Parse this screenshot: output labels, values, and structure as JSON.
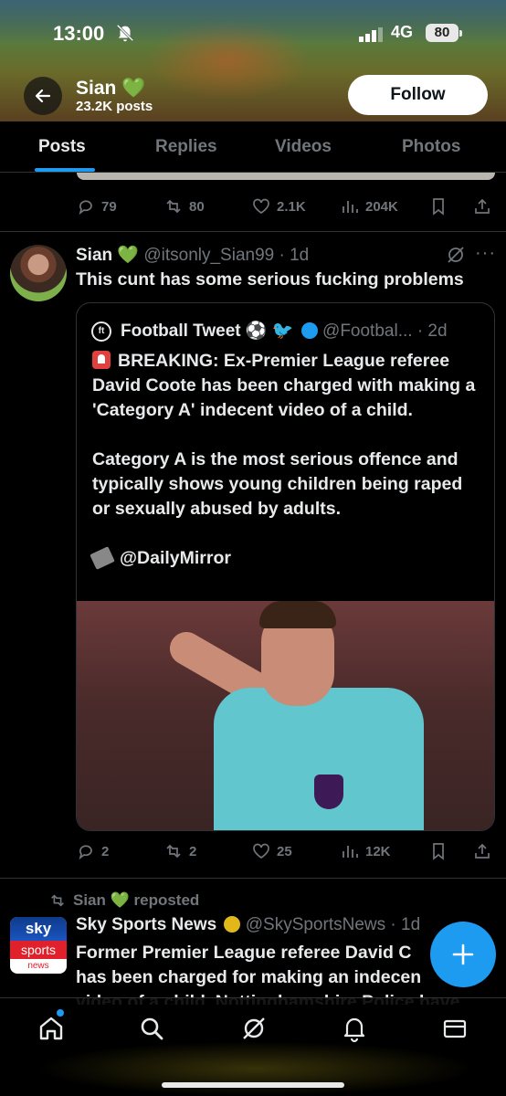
{
  "status_bar": {
    "time": "13:00",
    "network": "4G",
    "battery": "80"
  },
  "header": {
    "name": "Sian 💚",
    "posts_count": "23.2K posts",
    "follow_label": "Follow"
  },
  "tabs": [
    {
      "label": "Posts",
      "active": true
    },
    {
      "label": "Replies",
      "active": false
    },
    {
      "label": "Videos",
      "active": false
    },
    {
      "label": "Photos",
      "active": false
    }
  ],
  "previous_post": {
    "actions": {
      "replies": "79",
      "reposts": "80",
      "likes": "2.1K",
      "views": "204K"
    }
  },
  "post": {
    "name": "Sian 💚",
    "handle": "@itsonly_Sian99",
    "time": "· 1d",
    "text": "This cunt has some serious fucking problems",
    "quote": {
      "logo_text": "ft",
      "name": "Football Tweet ⚽ 🐦",
      "handle": "@Footbal...",
      "time": "· 2d",
      "line1": "BREAKING: Ex-Premier League referee David Coote has been charged with making a 'Category A' indecent video of a child.",
      "line2": "Category A is the most serious offence and typically shows young children being raped or sexually abused by adults.",
      "line3": "@DailyMirror"
    },
    "actions": {
      "replies": "2",
      "reposts": "2",
      "likes": "25",
      "views": "12K"
    }
  },
  "repost": {
    "reposted_by": "Sian 💚 reposted",
    "logo": {
      "top": "sky",
      "middle": "sports",
      "bottom": "news"
    },
    "name": "Sky Sports News",
    "handle": "@SkySportsNews",
    "time": "· 1d",
    "text_line1": "Former Premier League referee David C",
    "text_line2": "has been charged for making an indecen",
    "text_line3": "video of a child. Nottinghamshire Police have"
  },
  "icons": {
    "back": "arrow-left-icon",
    "reply": "reply-icon",
    "repost": "repost-icon",
    "like": "heart-icon",
    "views": "views-icon",
    "bookmark": "bookmark-icon",
    "share": "share-icon",
    "grok": "grok-icon",
    "compose": "plus-icon",
    "home": "home-icon",
    "search": "search-icon",
    "bell": "bell-icon",
    "mail": "mail-icon"
  },
  "colors": {
    "accent": "#1d9bf0",
    "background": "#000000",
    "muted": "#71767b",
    "text": "#e7e9ea"
  }
}
